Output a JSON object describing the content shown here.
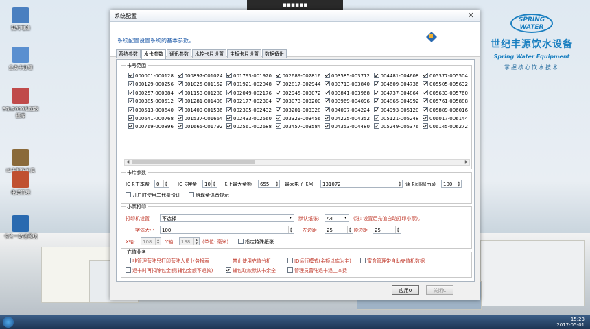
{
  "desktop": {
    "icons": [
      {
        "label": "我的电脑",
        "icon": "computer-icon",
        "color": "#4a7fc0"
      },
      {
        "label": "业务卡办理",
        "icon": "card-icon",
        "color": "#5a8fd0"
      },
      {
        "label": "SQL2000附加数据库",
        "icon": "database-icon",
        "color": "#c04a4a"
      },
      {
        "label": "IC卡制作工具",
        "icon": "tools-icon",
        "color": "#8a6a3a"
      },
      {
        "label": "电话管理",
        "icon": "house-icon",
        "color": "#c05030"
      },
      {
        "label": "卡片一站通系统",
        "icon": "app-icon",
        "color": "#2a6ab0"
      }
    ],
    "top_strip": "▪▪▪▪▪▪",
    "brand": {
      "logo_line1": "SPRING",
      "logo_line2": "WATER",
      "name_cn": "世纪丰源饮水设备",
      "name_en": "Spring Water Equipment",
      "slogan": "掌握核心饮水技术"
    },
    "taskbar": {
      "time": "15:23",
      "date": "2017-05-01"
    }
  },
  "window": {
    "title": "系统配置",
    "banner_text": "系统配置设置系统的基本参数。",
    "tabs": [
      "系统参数",
      "发卡参数",
      "通迅参数",
      "水控卡片设置",
      "主板卡片设置",
      "数据备份"
    ],
    "active_tab": 1,
    "card_range": {
      "title": "卡号范围",
      "rows": [
        [
          "000001-000128",
          "000897-001024",
          "001793-001920",
          "002689-002816",
          "003585-003712",
          "004481-004608",
          "005377-005504"
        ],
        [
          "000129-000256",
          "001025-001152",
          "001921-002048",
          "002817-002944",
          "003713-003840",
          "004609-004736",
          "005505-005632"
        ],
        [
          "000257-000384",
          "001153-001280",
          "002049-002176",
          "002945-003072",
          "003841-003968",
          "004737-004864",
          "005633-005760"
        ],
        [
          "000385-000512",
          "001281-001408",
          "002177-002304",
          "003073-003200",
          "003969-004096",
          "004865-004992",
          "005761-005888"
        ],
        [
          "000513-000640",
          "001409-001536",
          "002305-002432",
          "003201-003328",
          "004097-004224",
          "004993-005120",
          "005889-006016"
        ],
        [
          "000641-000768",
          "001537-001664",
          "002433-002560",
          "003329-003456",
          "004225-004352",
          "005121-005248",
          "006017-006144"
        ],
        [
          "000769-000896",
          "001665-001792",
          "002561-002688",
          "003457-003584",
          "004353-004480",
          "005249-005376",
          "006145-006272"
        ]
      ]
    },
    "card_params": {
      "title": "卡片参数",
      "ic_fee_label": "IC卡工本费",
      "ic_fee": "0",
      "deposit_label": "IC卡押金",
      "deposit": "10",
      "max_amount_label": "卡上最大金额",
      "max_amount": "655",
      "max_card_label": "最大电子卡号",
      "max_card": "131072",
      "interval_label": "读卡间隔(ms)",
      "interval": "100",
      "check1": "开户时使用二代身份证",
      "check2": "给现金语音提示"
    },
    "receipt_print": {
      "title": "小票打印",
      "printer_label": "打印机设置",
      "printer_value": "不选择",
      "paper_label": "默认纸张:",
      "paper_value": "A4",
      "note": "(注: 设置后充值自动打印小票)。",
      "font_label": "字体大小",
      "font_value": "100",
      "left_label": "左边距",
      "left_value": "25",
      "top_label": "顶边距",
      "top_value": "25",
      "x_label": "X轴:",
      "x_value": "108",
      "y_label": "Y轴:",
      "y_value": "138",
      "unit": "(单位: 毫米)",
      "special_paper": "指定特殊纸张"
    },
    "recharge": {
      "title": "充值业务",
      "items": [
        {
          "label": "非管理营陆只打印营陆人员业务报表",
          "checked": false
        },
        {
          "label": "禁止使用充值分析",
          "checked": false
        },
        {
          "label": "ID运行模式(金额以库为主)",
          "checked": false
        },
        {
          "label": "富盒管理带自助充值机数据",
          "checked": false
        },
        {
          "label": "退卡时再扣除包金额(辅包金额不退款)",
          "checked": false
        },
        {
          "label": "辅包取款默认卡余全",
          "checked": true
        },
        {
          "label": "管理员营陆退卡退工本费",
          "checked": false
        }
      ]
    },
    "buttons": {
      "apply": "应用0",
      "close": "关闭C"
    }
  }
}
